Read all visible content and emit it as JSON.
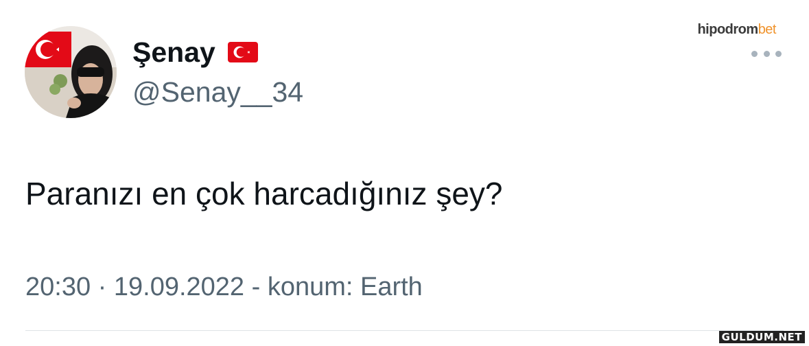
{
  "tweet": {
    "display_name": "Şenay",
    "handle": "@Senay__34",
    "text": "Paranızı en çok harcadığınız şey?",
    "meta": "20:30 · 19.09.2022 - konum: Earth"
  },
  "brand": {
    "part1": "hipodrom",
    "part2": "bet"
  },
  "watermark": "GULDUM.NET",
  "icons": {
    "flag": "turkey-flag-icon",
    "more": "more-options-icon"
  },
  "colors": {
    "name": "#0f1419",
    "secondary": "#536471",
    "flag_red": "#e30a17",
    "brand_orange": "#f0922a"
  }
}
